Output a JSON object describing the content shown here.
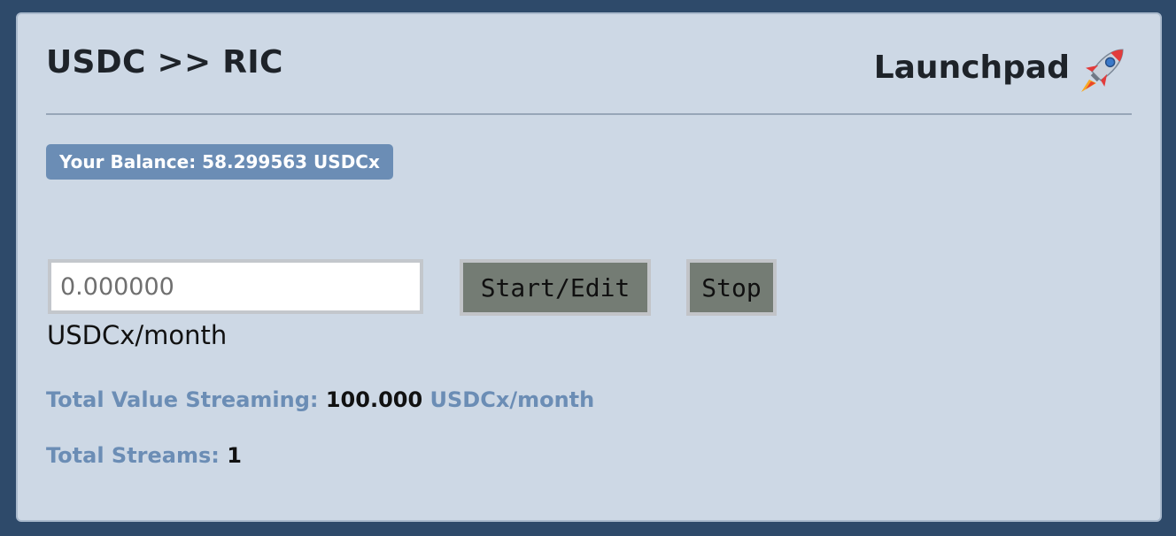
{
  "header": {
    "title": "USDC >> RIC",
    "launchpad_label": "Launchpad",
    "launchpad_icon": "rocket-icon"
  },
  "balance": {
    "text": "Your Balance: 58.299563 USDCx"
  },
  "stream_form": {
    "amount_placeholder": "0.000000",
    "amount_value": "",
    "unit_label": "USDCx/month",
    "start_button_label": "Start/Edit",
    "stop_button_label": "Stop"
  },
  "stats": {
    "total_value_streaming_label": "Total Value Streaming:",
    "total_value_streaming_value": "100.000",
    "total_value_streaming_unit": "USDCx/month",
    "total_streams_label": "Total Streams:",
    "total_streams_value": "1"
  },
  "colors": {
    "page_background": "#2e4a6a",
    "card_background": "#cdd8e5",
    "accent": "#6b8db5",
    "button_background": "#747c74"
  }
}
